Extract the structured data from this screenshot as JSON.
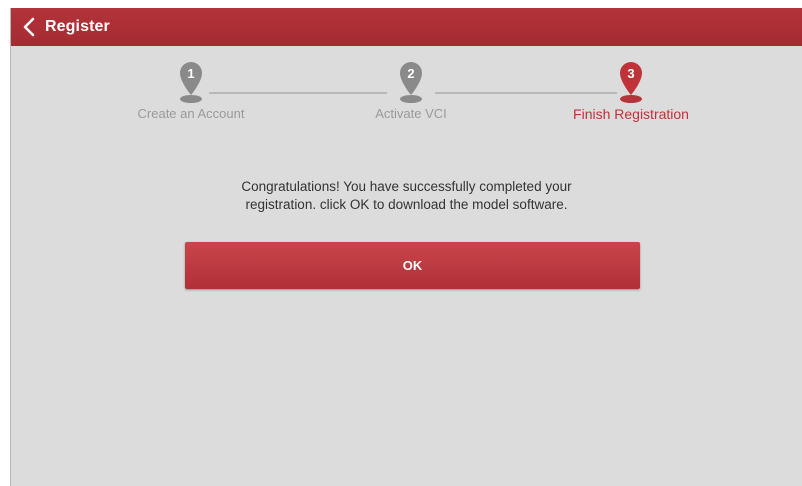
{
  "header": {
    "back_icon": "chevron-left-icon",
    "title": "Register"
  },
  "stepper": {
    "steps": [
      {
        "number": "1",
        "label": "Create an Account",
        "state": "inactive"
      },
      {
        "number": "2",
        "label": "Activate VCI",
        "state": "inactive"
      },
      {
        "number": "3",
        "label": "Finish Registration",
        "state": "active"
      }
    ]
  },
  "main": {
    "message_line1": "Congratulations! You have successfully completed your",
    "message_line2": "registration. click OK to download the model software.",
    "ok_label": "OK"
  },
  "colors": {
    "brand_red": "#a52a31",
    "active_step": "#c0323a",
    "inactive_step": "#8a8a8a",
    "background": "#dcdcdc"
  }
}
